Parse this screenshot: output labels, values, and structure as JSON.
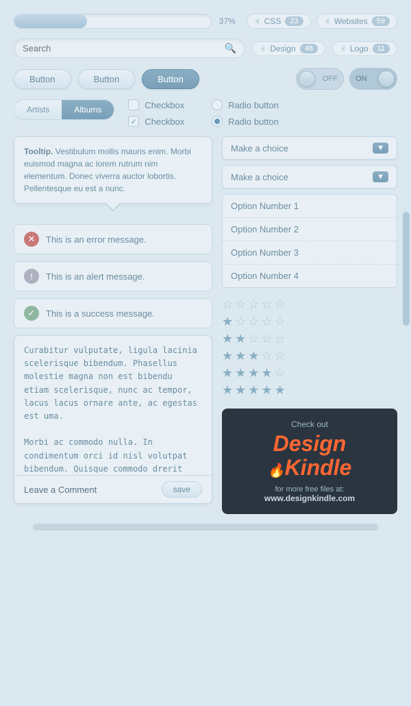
{
  "progress": {
    "value": 37,
    "label": "37%"
  },
  "tags": [
    {
      "name": "CSS",
      "count": "23"
    },
    {
      "name": "Websites",
      "count": "59"
    },
    {
      "name": "Design",
      "count": "48"
    },
    {
      "name": "Logo",
      "count": "11"
    }
  ],
  "search": {
    "placeholder": "Search",
    "icon": "🔍"
  },
  "buttons": [
    {
      "label": "Button",
      "active": false
    },
    {
      "label": "Button",
      "active": false
    },
    {
      "label": "Button",
      "active": true
    }
  ],
  "toggles": [
    {
      "label": "OFF",
      "on": false
    },
    {
      "label": "ON",
      "on": true
    }
  ],
  "tabs": [
    {
      "label": "Artists",
      "active": false
    },
    {
      "label": "Albums",
      "active": true
    }
  ],
  "checkboxes": [
    {
      "label": "Checkbox",
      "checked": false
    },
    {
      "label": "Checkbox",
      "checked": true
    }
  ],
  "radios": [
    {
      "label": "Radio button",
      "checked": false
    },
    {
      "label": "Radio button",
      "checked": true
    }
  ],
  "tooltip": {
    "bold": "Tooltip.",
    "text": " Vestibulum mollis mauris enim. Morbi euismod magna ac lorem rutrum nim elementum. Donec viverra auctor lobortis. Pellentesque eu est a nunc."
  },
  "dropdown": {
    "placeholder": "Make a choice",
    "options": [
      "Option Number 1",
      "Option Number 2",
      "Option Number 3",
      "Option Number 4"
    ]
  },
  "messages": {
    "error": "This is an error message.",
    "alert": "This is an alert message.",
    "success": "This is a success message."
  },
  "stars": [
    [
      0,
      0,
      0,
      0,
      0
    ],
    [
      1,
      0,
      0,
      0,
      0
    ],
    [
      1,
      1,
      0,
      0,
      0
    ],
    [
      1,
      1,
      1,
      0,
      0
    ],
    [
      1,
      1,
      1,
      1,
      0
    ],
    [
      1,
      1,
      1,
      1,
      1
    ]
  ],
  "comment": {
    "text": "Curabitur vulputate, ligula lacinia scelerisque bibendum. Phasellus molestie magna non est bibendu etiam scelerisque, nunc ac tempor, lacus lacus ornare ante, ac egestas est uma.\n\nMorbi ac commodo nulla. In condimentum orci id nisl volutpat bibendum. Quisque commodo drerit lorem quis.\n\nPellentesque eu est a nulla placerat dignissimr egestas. Duis aliquet egestas purus elerisque tempor, lacus lacus ornare antac.",
    "footer_label": "Leave a Comment",
    "save_label": "save"
  },
  "kindle": {
    "check_out": "Check out",
    "brand_line1": "Design",
    "brand_line2": "Kindle",
    "tagline": "for more free files at:",
    "url": "www.designkindle.com"
  }
}
